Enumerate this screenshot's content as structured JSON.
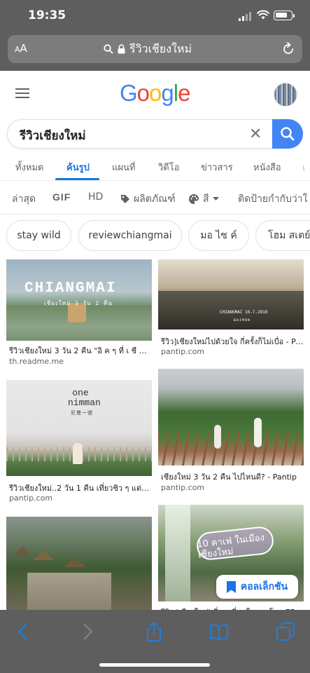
{
  "status_bar": {
    "time": "19:35"
  },
  "safari": {
    "aa_label_big": "A",
    "aa_label_small": "A",
    "url_text": "รีวิวเชียงใหม่"
  },
  "google": {
    "logo_letters": [
      "G",
      "o",
      "o",
      "g",
      "l",
      "e"
    ],
    "logo_colors": [
      "#4285f4",
      "#ea4335",
      "#fbbc05",
      "#4285f4",
      "#34a853",
      "#ea4335"
    ],
    "search_query": "รีวิวเชียงใหม่",
    "clear_symbol": "✕"
  },
  "tabs": [
    {
      "label": "ทั้งหมด"
    },
    {
      "label": "ค้นรูป"
    },
    {
      "label": "แผนที่"
    },
    {
      "label": "วิดีโอ"
    },
    {
      "label": "ข่าวสาร"
    },
    {
      "label": "หนังสือ"
    },
    {
      "label": "เ"
    }
  ],
  "active_tab": "ค้นรูป",
  "tools": {
    "latest": "ล่าสุด",
    "gif": "GIF",
    "hd": "HD",
    "products": "ผลิตภัณฑ์",
    "color": "สี",
    "labels": "ติดป้ายกำกับว่าใ"
  },
  "chips": [
    "stay wild",
    "reviewchiangmai",
    "มอ ไซ ค์",
    "โฮม สเตย์"
  ],
  "results": [
    {
      "title": "รีวิวเชียงใหม่ 3 วัน 2 คืน \"อิ ค ๆ ที่ เ ชี ย ง ...",
      "source": "th.readme.me",
      "overlay": "CHIANGMAI",
      "overlay_sub": "เชียงใหม่ 3 วัน 2 คืน"
    },
    {
      "title": "รีวิว]เชียงใหม่ไปด้วยใจ กี่ครั้งก็ไม่เบื่อ - Pa...",
      "source": "pantip.com",
      "overlay": "CHIANGMAI 16-7.2019",
      "overlay_sub": "BAIMON"
    },
    {
      "title": "รีวิวเชียงใหม่..2 วัน 1 คืน เที่ยวชิว ๆ แต่รูปเ...",
      "source": "pantip.com",
      "overlay": "one nimman",
      "overlay_sub": "尼曼一號"
    },
    {
      "title": "เชียงใหม่ 3 วัน 2 คืน ไปไหนดี? - Pantip",
      "source": "pantip.com"
    },
    {
      "title": "",
      "source": ""
    },
    {
      "title": "รีวิว 'เชียงใหม่' ที่สวยที่สุดในสามโลก EP...",
      "source": "",
      "overlay": "10 คาเฟ่ ในเมืองเชียงใหม่",
      "overlay_sub": ""
    }
  ],
  "collection_label": "คอลเล็กชัน",
  "icons": {
    "back": "chevron-left-icon",
    "forward": "chevron-right-icon",
    "share": "share-icon",
    "bookmarks": "book-icon",
    "tabs": "tabs-icon"
  }
}
